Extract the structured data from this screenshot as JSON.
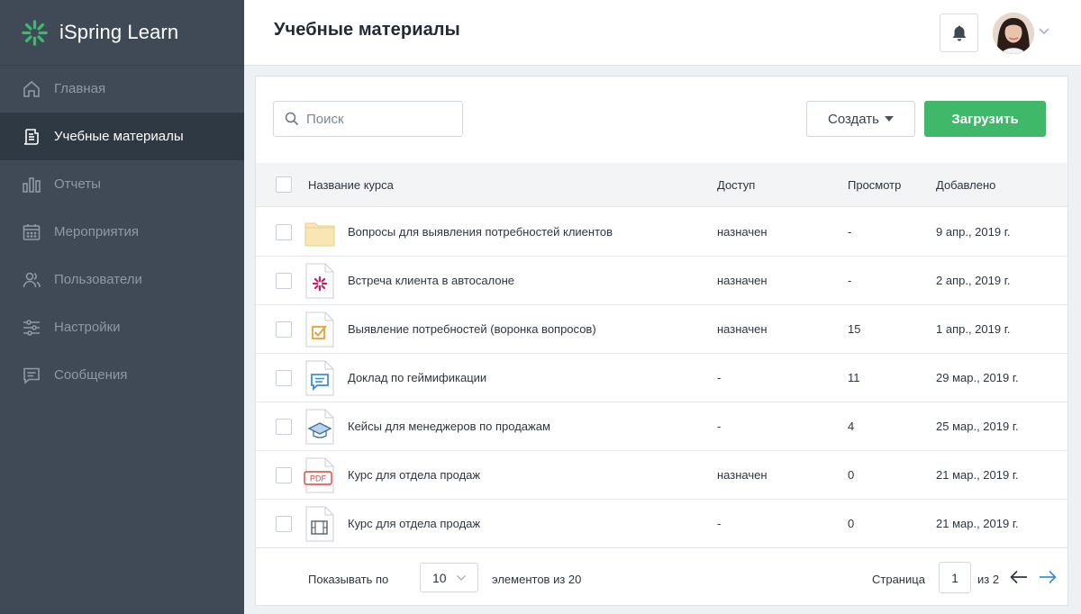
{
  "app": {
    "name": "iSpring Learn",
    "brand_color": "#3fb86a"
  },
  "sidebar": {
    "items": [
      {
        "label": "Главная",
        "icon": "home-icon",
        "active": false
      },
      {
        "label": "Учебные материалы",
        "icon": "document-icon",
        "active": true
      },
      {
        "label": "Отчеты",
        "icon": "bar-chart-icon",
        "active": false
      },
      {
        "label": "Мероприятия",
        "icon": "calendar-icon",
        "active": false
      },
      {
        "label": "Пользователи",
        "icon": "users-icon",
        "active": false
      },
      {
        "label": "Настройки",
        "icon": "sliders-icon",
        "active": false
      },
      {
        "label": "Сообщения",
        "icon": "message-icon",
        "active": false
      }
    ]
  },
  "header": {
    "title": "Учебные материалы"
  },
  "toolbar": {
    "search_placeholder": "Поиск",
    "create_label": "Создать",
    "upload_label": "Загрузить"
  },
  "table": {
    "columns": [
      "Название курса",
      "Доступ",
      "Просмотр",
      "Добавлено"
    ],
    "rows": [
      {
        "icon": "folder-icon",
        "name": "Вопросы для выявления потребностей клиентов",
        "access": "назначен",
        "views": "-",
        "added": "9 апр., 2019 г."
      },
      {
        "icon": "ispring-course-icon",
        "name": "Встреча клиента в автосалоне",
        "access": "назначен",
        "views": "-",
        "added": "2 апр., 2019 г."
      },
      {
        "icon": "quiz-icon",
        "name": "Выявление потребностей (воронка вопросов)",
        "access": "назначен",
        "views": "15",
        "added": "1 апр., 2019 г."
      },
      {
        "icon": "dialog-icon",
        "name": "Доклад по геймификации",
        "access": "-",
        "views": "11",
        "added": "29 мар., 2019 г."
      },
      {
        "icon": "graduation-cap-icon",
        "name": "Кейсы для менеджеров по продажам",
        "access": "-",
        "views": "4",
        "added": "25 мар., 2019 г."
      },
      {
        "icon": "pdf-icon",
        "name": "Курс для отдела продаж",
        "access": "назначен",
        "views": "0",
        "added": "21 мар., 2019 г."
      },
      {
        "icon": "video-icon",
        "name": "Курс для отдела продаж",
        "access": "-",
        "views": "0",
        "added": "21 мар., 2019 г."
      }
    ]
  },
  "footer": {
    "show_per_label": "Показывать по",
    "per_page_value": "10",
    "items_of_label": "элементов из 20",
    "page_label": "Страница",
    "current_page": "1",
    "of_pages_label": "из 2"
  },
  "pdf_badge_text": "PDF"
}
